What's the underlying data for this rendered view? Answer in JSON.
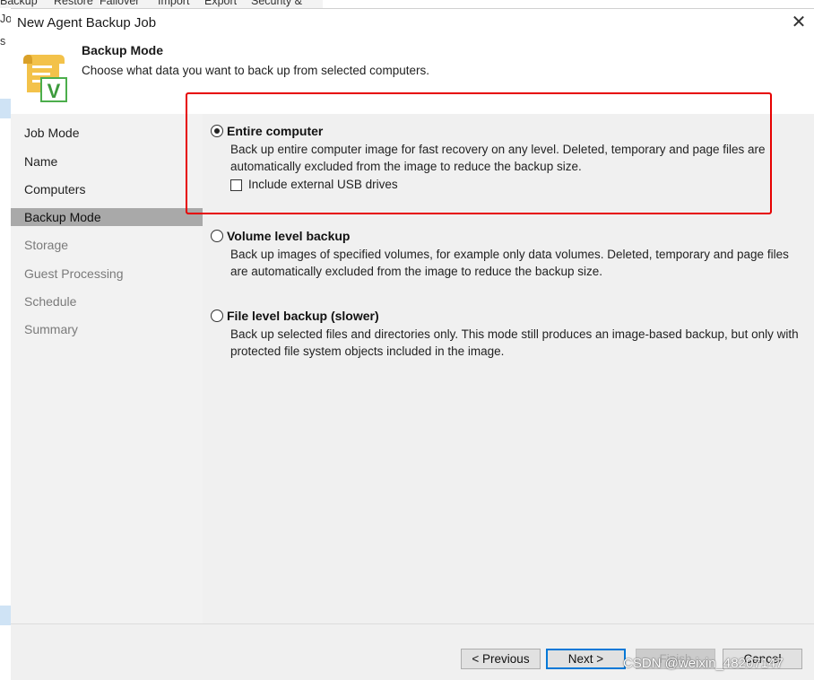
{
  "background_window": {
    "menu_items": [
      "Backup",
      "Restore",
      "Failover",
      "Import",
      "Export",
      "Security &"
    ],
    "left_labels": [
      "Jo",
      "s"
    ]
  },
  "dialog": {
    "title": "New Agent Backup Job",
    "close_glyph": "✕"
  },
  "header": {
    "icon": "backup-scroll-icon",
    "icon_letter": "V",
    "title": "Backup Mode",
    "description": "Choose what data you want to back up from selected computers."
  },
  "steps": [
    {
      "label": "Job Mode",
      "state": "done"
    },
    {
      "label": "Name",
      "state": "done"
    },
    {
      "label": "Computers",
      "state": "done"
    },
    {
      "label": "Backup Mode",
      "state": "active"
    },
    {
      "label": "Storage",
      "state": "pending"
    },
    {
      "label": "Guest Processing",
      "state": "pending"
    },
    {
      "label": "Schedule",
      "state": "pending"
    },
    {
      "label": "Summary",
      "state": "pending"
    }
  ],
  "options": [
    {
      "title": "Entire computer",
      "selected": true,
      "description": "Back up entire computer image for fast recovery on any level. Deleted, temporary and page files are automatically excluded from the image to reduce the backup size.",
      "checkbox": {
        "label": "Include external USB drives",
        "checked": false
      }
    },
    {
      "title": "Volume level backup",
      "selected": false,
      "description": "Back up images of specified volumes, for example only data volumes. Deleted, temporary and page files are automatically excluded from the image to reduce the backup size."
    },
    {
      "title": "File level backup (slower)",
      "selected": false,
      "description": "Back up selected files and directories only. This mode still produces an image-based backup, but only with protected file system objects included in the image."
    }
  ],
  "buttons": {
    "previous": "< Previous",
    "next": "Next >",
    "finish": "Finish",
    "cancel": "Cancel"
  },
  "watermark": "CSDN @weixin_48207147",
  "colors": {
    "highlight_border": "#e60000",
    "active_step_bg": "#a9a9a9",
    "sidebar_bg": "#f2f2f2",
    "content_bg": "#f0f0f0",
    "primary_button_border": "#0078d7"
  }
}
